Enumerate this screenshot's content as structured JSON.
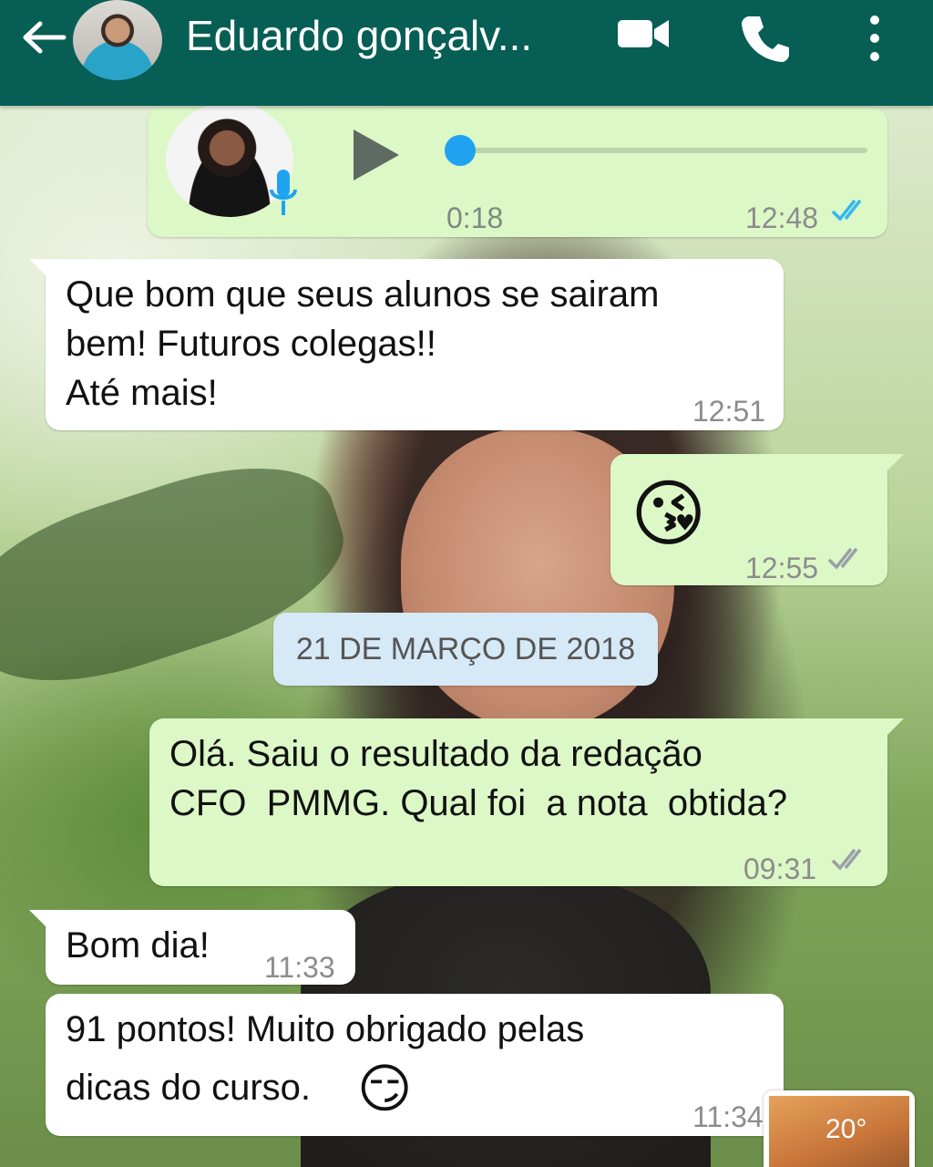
{
  "header": {
    "contact_name": "Eduardo gonçalv...",
    "icons": [
      "back-arrow-icon",
      "video-call-icon",
      "phone-call-icon",
      "more-options-icon"
    ],
    "color": "#075e54"
  },
  "voice_message": {
    "duration": "0:18",
    "time": "12:48",
    "progress": 0.0,
    "ticks_color": "#34b7f1"
  },
  "messages": [
    {
      "direction": "in",
      "lines": [
        "Que bom que seus alunos se sairam",
        "bem! Futuros colegas!!",
        "Até mais!"
      ],
      "time": "12:51"
    },
    {
      "direction": "out",
      "emoji": "😘",
      "time": "12:55"
    },
    {
      "direction": "out",
      "lines": [
        "Olá. Saiu o resultado da redação",
        "CFO  PMMG. Qual foi  a nota  obtida?"
      ],
      "time": "09:31"
    },
    {
      "direction": "in",
      "text": "Bom dia!",
      "time": "11:33"
    },
    {
      "direction": "in",
      "lines": [
        "91 pontos! Muito obrigado pelas",
        "dicas do curso."
      ],
      "emoji": "😏",
      "time": "11:34"
    }
  ],
  "date_separator": "21 DE MARÇO DE 2018",
  "thumbnail": {
    "temperature": "20°"
  },
  "colors": {
    "incoming": "#ffffff",
    "outgoing": "#dcf8c6",
    "date_chip": "#d6e9f6",
    "read_ticks_blue": "#34b7f1",
    "ticks_grey": "#9aa0a6"
  }
}
